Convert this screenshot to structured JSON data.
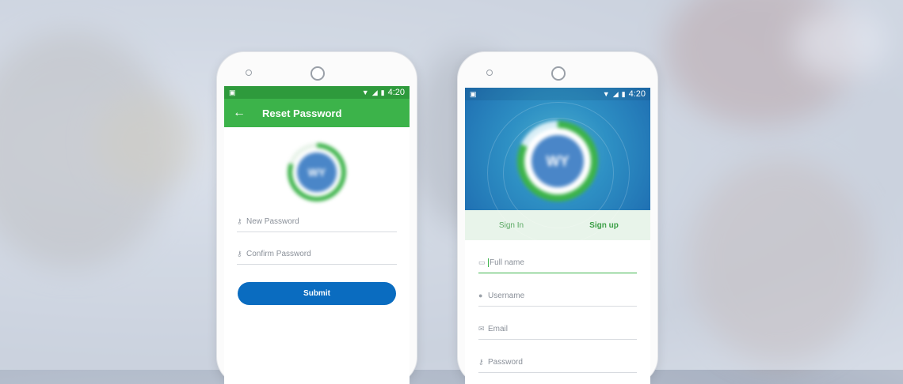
{
  "left_phone": {
    "status": {
      "time": "4:20"
    },
    "appbar": {
      "back_icon": "arrow-left-icon",
      "title": "Reset Password"
    },
    "logo": {
      "text": "WY"
    },
    "fields": [
      {
        "icon": "key-icon",
        "placeholder": "New Password"
      },
      {
        "icon": "key-icon",
        "placeholder": "Confirm Password"
      }
    ],
    "submit_label": "Submit"
  },
  "right_phone": {
    "status": {
      "time": "4:20"
    },
    "logo": {
      "text": "WY"
    },
    "tabs": [
      {
        "label": "Sign In",
        "active": false
      },
      {
        "label": "Sign up",
        "active": true
      }
    ],
    "fields": [
      {
        "icon": "id-card-icon",
        "placeholder": "Full name",
        "focused": true
      },
      {
        "icon": "person-icon",
        "placeholder": "Username"
      },
      {
        "icon": "mail-icon",
        "placeholder": "Email"
      },
      {
        "icon": "key-icon",
        "placeholder": "Password"
      }
    ]
  },
  "colors": {
    "green": "#3cb34a",
    "blue_button": "#0a6cc0",
    "hero_blue": "#2e90c4",
    "tab_bg": "#e8f4ea"
  }
}
